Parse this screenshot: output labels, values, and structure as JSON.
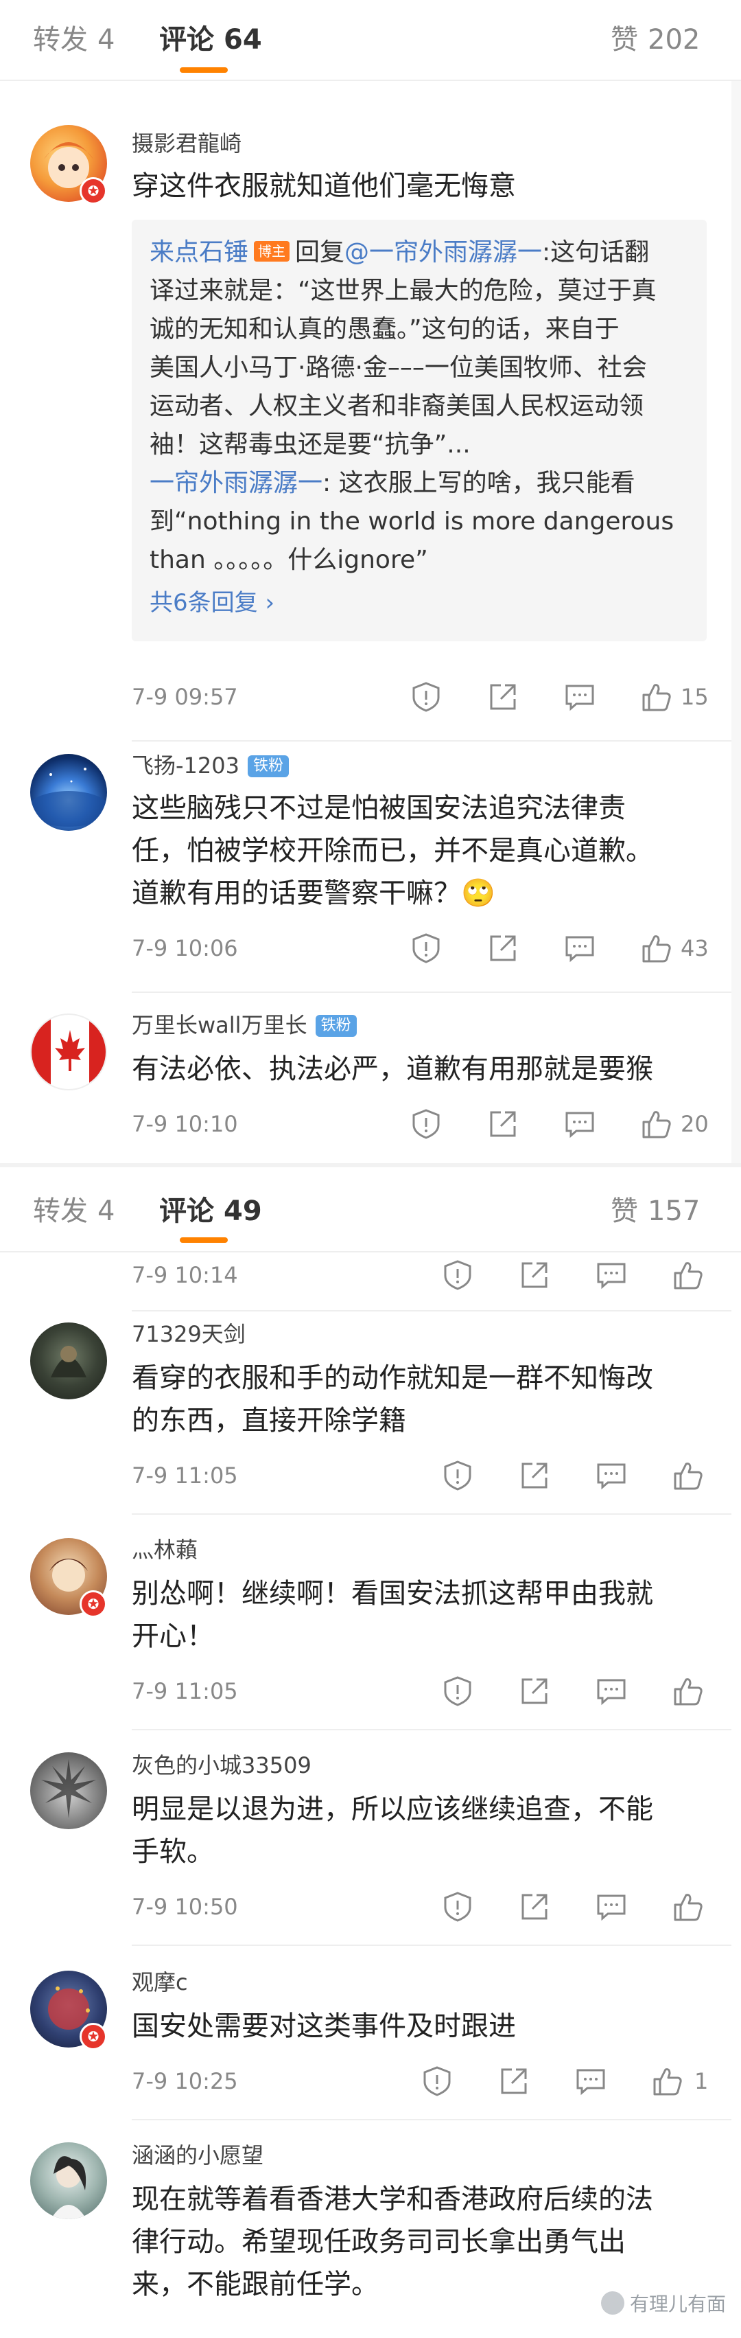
{
  "panel1": {
    "tabs": {
      "repost": {
        "label": "转发",
        "count": "4"
      },
      "comments": {
        "label": "评论",
        "count": "64"
      },
      "likes": {
        "label": "赞",
        "count": "202"
      }
    },
    "comments": [
      {
        "user": "摄影君龍崎",
        "text": "穿这件衣服就知道他们毫无悔意",
        "reply": {
          "author": "来点石锤",
          "author_badge": "博主",
          "reply_word": "回复",
          "target": "@一帘外雨潺潺一",
          "lines_after_target": ":这句话翻",
          "lines": [
            "译过来就是：“这世界上最大的危险，莫过于真",
            "诚的无知和认真的愚蠢。”这句的话，来自于",
            "美国人小马丁·路德·金–––一位美国牧师、社会",
            "运动者、人权主义者和非裔美国人民权运动领",
            "袖！这帮毒虫还是要“抗争”..."
          ],
          "second_author": "一帘外雨潺潺一",
          "second_text_first": ": 这衣服上写的啥，我只能看",
          "second_lines": [
            "到“nothing in the world is more dangerous",
            "than 。。。。。什么ignore”"
          ],
          "more": "共6条回复 ›"
        },
        "time": "7-9 09:57",
        "likes": "15"
      },
      {
        "user": "飞扬-1203",
        "badge": "铁粉",
        "lines": [
          "这些脑残只不过是怕被国安法追究法律责",
          "任，怕被学校开除而已，并不是真心道歉。",
          "道歉有用的话要警察干嘛？🙄"
        ],
        "time": "7-9 10:06",
        "likes": "43"
      },
      {
        "user": "万里长wall万里长",
        "badge": "铁粉",
        "text": "有法必依、执法必严，道歉有用那就是要猴",
        "time": "7-9 10:10",
        "likes": "20"
      }
    ]
  },
  "panel2": {
    "tabs": {
      "repost": {
        "label": "转发",
        "count": "4"
      },
      "comments": {
        "label": "评论",
        "count": "49"
      },
      "likes": {
        "label": "赞",
        "count": "157"
      }
    },
    "first_meta_time": "7-9 10:14",
    "comments": [
      {
        "user": "71329天剑",
        "lines": [
          "看穿的衣服和手的动作就知是一群不知悔改",
          "的东西，直接开除学籍"
        ],
        "time": "7-9 11:05"
      },
      {
        "user": "灬林藾",
        "lines": [
          "别怂啊！继续啊！看国安法抓这帮甲由我就",
          "开心！"
        ],
        "time": "7-9 11:05"
      },
      {
        "user": "灰色的小城33509",
        "lines": [
          "明显是以退为进，所以应该继续追查，不能",
          "手软。"
        ],
        "time": "7-9 10:50"
      },
      {
        "user": "观摩c",
        "lines": [
          "国安处需要对这类事件及时跟进"
        ],
        "time": "7-9 10:25",
        "likes": "1"
      },
      {
        "user": "涵涵的小愿望",
        "lines": [
          "现在就等着看香港大学和香港政府后续的法",
          "律行动。希望现任政务司司长拿出勇气出",
          "来，不能跟前任学。"
        ]
      }
    ],
    "watermark": "有理儿有面"
  },
  "icons": [
    "report-icon",
    "share-icon",
    "comment-icon",
    "like-icon"
  ],
  "colors": {
    "accent": "#ff8200",
    "link": "#4a7cc6",
    "fan_badge": "#5aa3e6",
    "host_badge": "#ff7a1f",
    "avatar_badge": "#e6352b"
  }
}
